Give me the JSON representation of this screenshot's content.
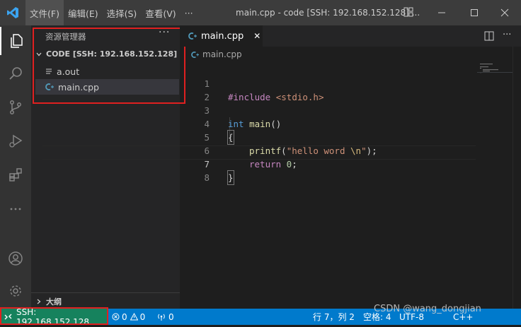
{
  "titlebar": {
    "menu": [
      "文件(F)",
      "编辑(E)",
      "选择(S)",
      "查看(V)",
      "···"
    ],
    "title": "main.cpp - code [SSH: 192.168.152.128] ..."
  },
  "explorer": {
    "header": "资源管理器",
    "more": "···",
    "folder": "CODE [SSH: 192.168.152.128]",
    "files": [
      "a.out",
      "main.cpp"
    ],
    "outline": "大纲"
  },
  "tab": {
    "label": "main.cpp",
    "close": "✕"
  },
  "breadcrumb": "main.cpp",
  "code": {
    "line_numbers": [
      "1",
      "2",
      "3",
      "4",
      "5",
      "6",
      "7",
      "8"
    ],
    "active_line": "7",
    "l1_pp": "#include",
    "l1_inc": " <stdio.h>",
    "l3_kw": "int",
    "l3_fn": " main",
    "l3_p": "()",
    "l4": "{",
    "l5_fn": "printf",
    "l5_p1": "(",
    "l5_str": "\"hello word ",
    "l5_esc": "\\n",
    "l5_str2": "\"",
    "l5_p2": ");",
    "l6_kw": "return",
    "l6_num": " 0",
    "l6_p": ";",
    "l7": "}"
  },
  "status": {
    "remote": "SSH: 192.168.152.128",
    "errors": "0",
    "warnings": "0",
    "ports": "0",
    "position": "行 7，列 2",
    "spaces": "空格: 4",
    "encoding": "UTF-8",
    "lang": "C++"
  },
  "watermark": "CSDN @wang_dongjian",
  "colors": {
    "statusbar": "#007acc",
    "remote": "#16825d",
    "highlight_box": "#e02020"
  }
}
